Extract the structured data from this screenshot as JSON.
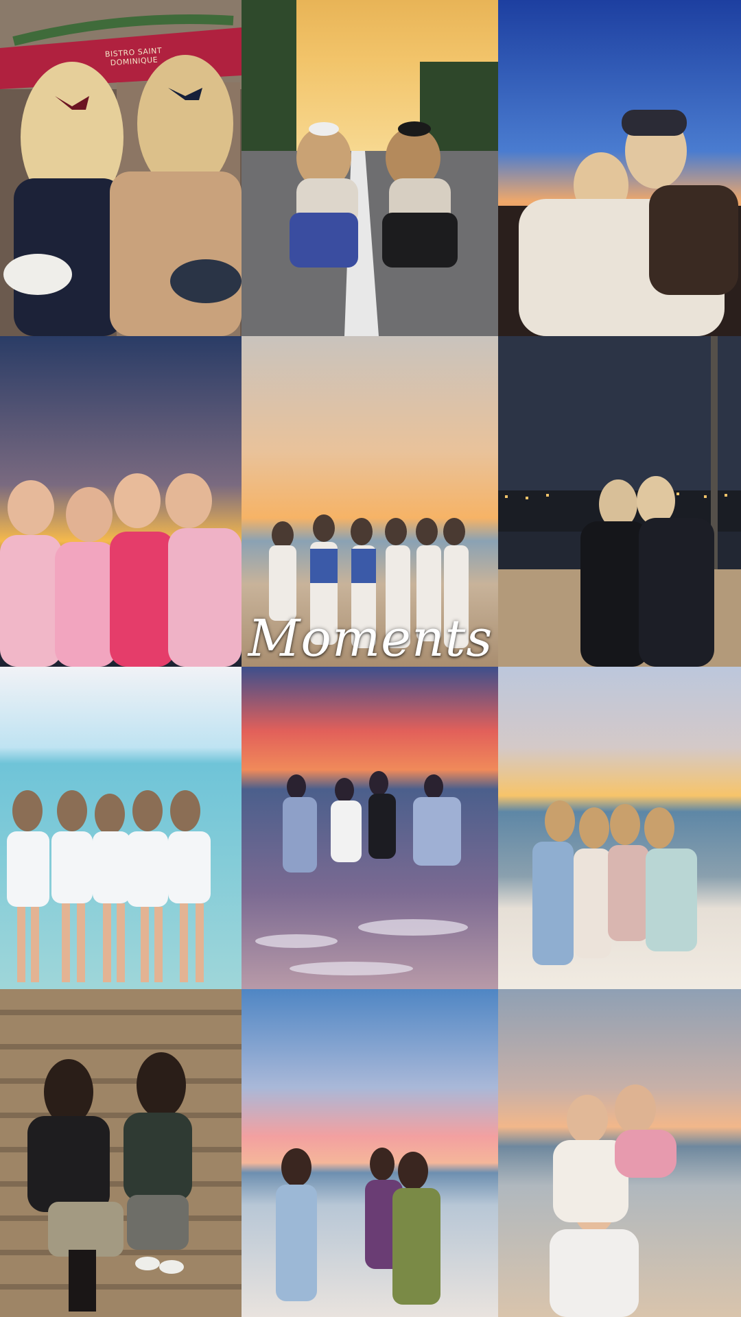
{
  "overlay": {
    "title": "Moments"
  },
  "tiles": [
    {
      "id": "tile-1",
      "sign": "BISTRO SAINT DOMINIQUE"
    },
    {
      "id": "tile-2"
    },
    {
      "id": "tile-3"
    },
    {
      "id": "tile-4"
    },
    {
      "id": "tile-5"
    },
    {
      "id": "tile-6"
    },
    {
      "id": "tile-7"
    },
    {
      "id": "tile-8"
    },
    {
      "id": "tile-9"
    },
    {
      "id": "tile-10"
    },
    {
      "id": "tile-11"
    },
    {
      "id": "tile-12"
    }
  ]
}
